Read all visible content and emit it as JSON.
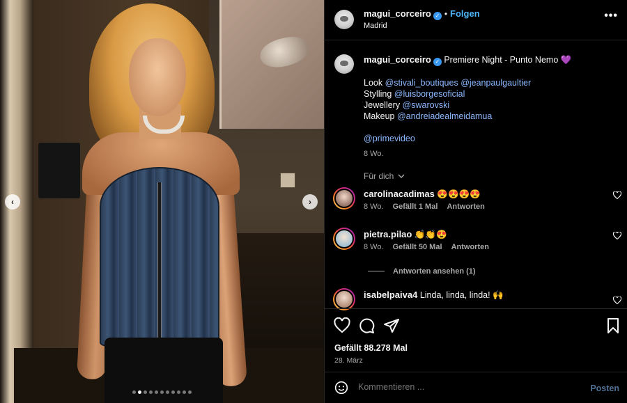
{
  "photo": {
    "prev_icon": "chevron-left-icon",
    "next_icon": "chevron-right-icon",
    "dots_total": 11,
    "dots_active": 1
  },
  "header": {
    "username": "magui_corceiro",
    "verified_icon": "verified-badge-icon",
    "separator": "•",
    "follow_label": "Folgen",
    "location": "Madrid",
    "more_icon": "more-icon"
  },
  "caption": {
    "username": "magui_corceiro",
    "title": "Premiere Night - Punto Nemo 💜",
    "lines": [
      {
        "label": "Look",
        "tags": [
          "@stivali_boutiques",
          "@jeanpaulgaultier"
        ]
      },
      {
        "label": "Stylling",
        "tags": [
          "@luisborgesoficial"
        ]
      },
      {
        "label": "Jewellery",
        "tags": [
          "@swarovski"
        ]
      },
      {
        "label": "Makeup",
        "tags": [
          "@andreiadealmeidamua"
        ]
      }
    ],
    "extra_tag": "@primevideo",
    "time": "8 Wo."
  },
  "filter": {
    "label": "Für dich",
    "icon": "chevron-down-icon"
  },
  "comments": [
    {
      "username": "carolinacadimas",
      "text": "😍😍😍😍",
      "time": "8 Wo.",
      "likes": "Gefällt 1 Mal",
      "reply": "Antworten"
    },
    {
      "username": "pietra.pilao",
      "text": "👏👏😍",
      "time": "8 Wo.",
      "likes": "Gefällt 50 Mal",
      "reply": "Antworten"
    },
    {
      "username": "isabelpaiva4",
      "text": "Linda, linda, linda! 🙌",
      "time": "",
      "likes": "",
      "reply": ""
    }
  ],
  "view_replies": "Antworten ansehen (1)",
  "actions": {
    "like_icon": "heart-icon",
    "comment_icon": "comment-icon",
    "share_icon": "share-icon",
    "save_icon": "bookmark-icon"
  },
  "likes": "Gefällt 88.278 Mal",
  "date": "28. März",
  "composer": {
    "emoji_icon": "emoji-icon",
    "placeholder": "Kommentieren ...",
    "post_label": "Posten"
  }
}
